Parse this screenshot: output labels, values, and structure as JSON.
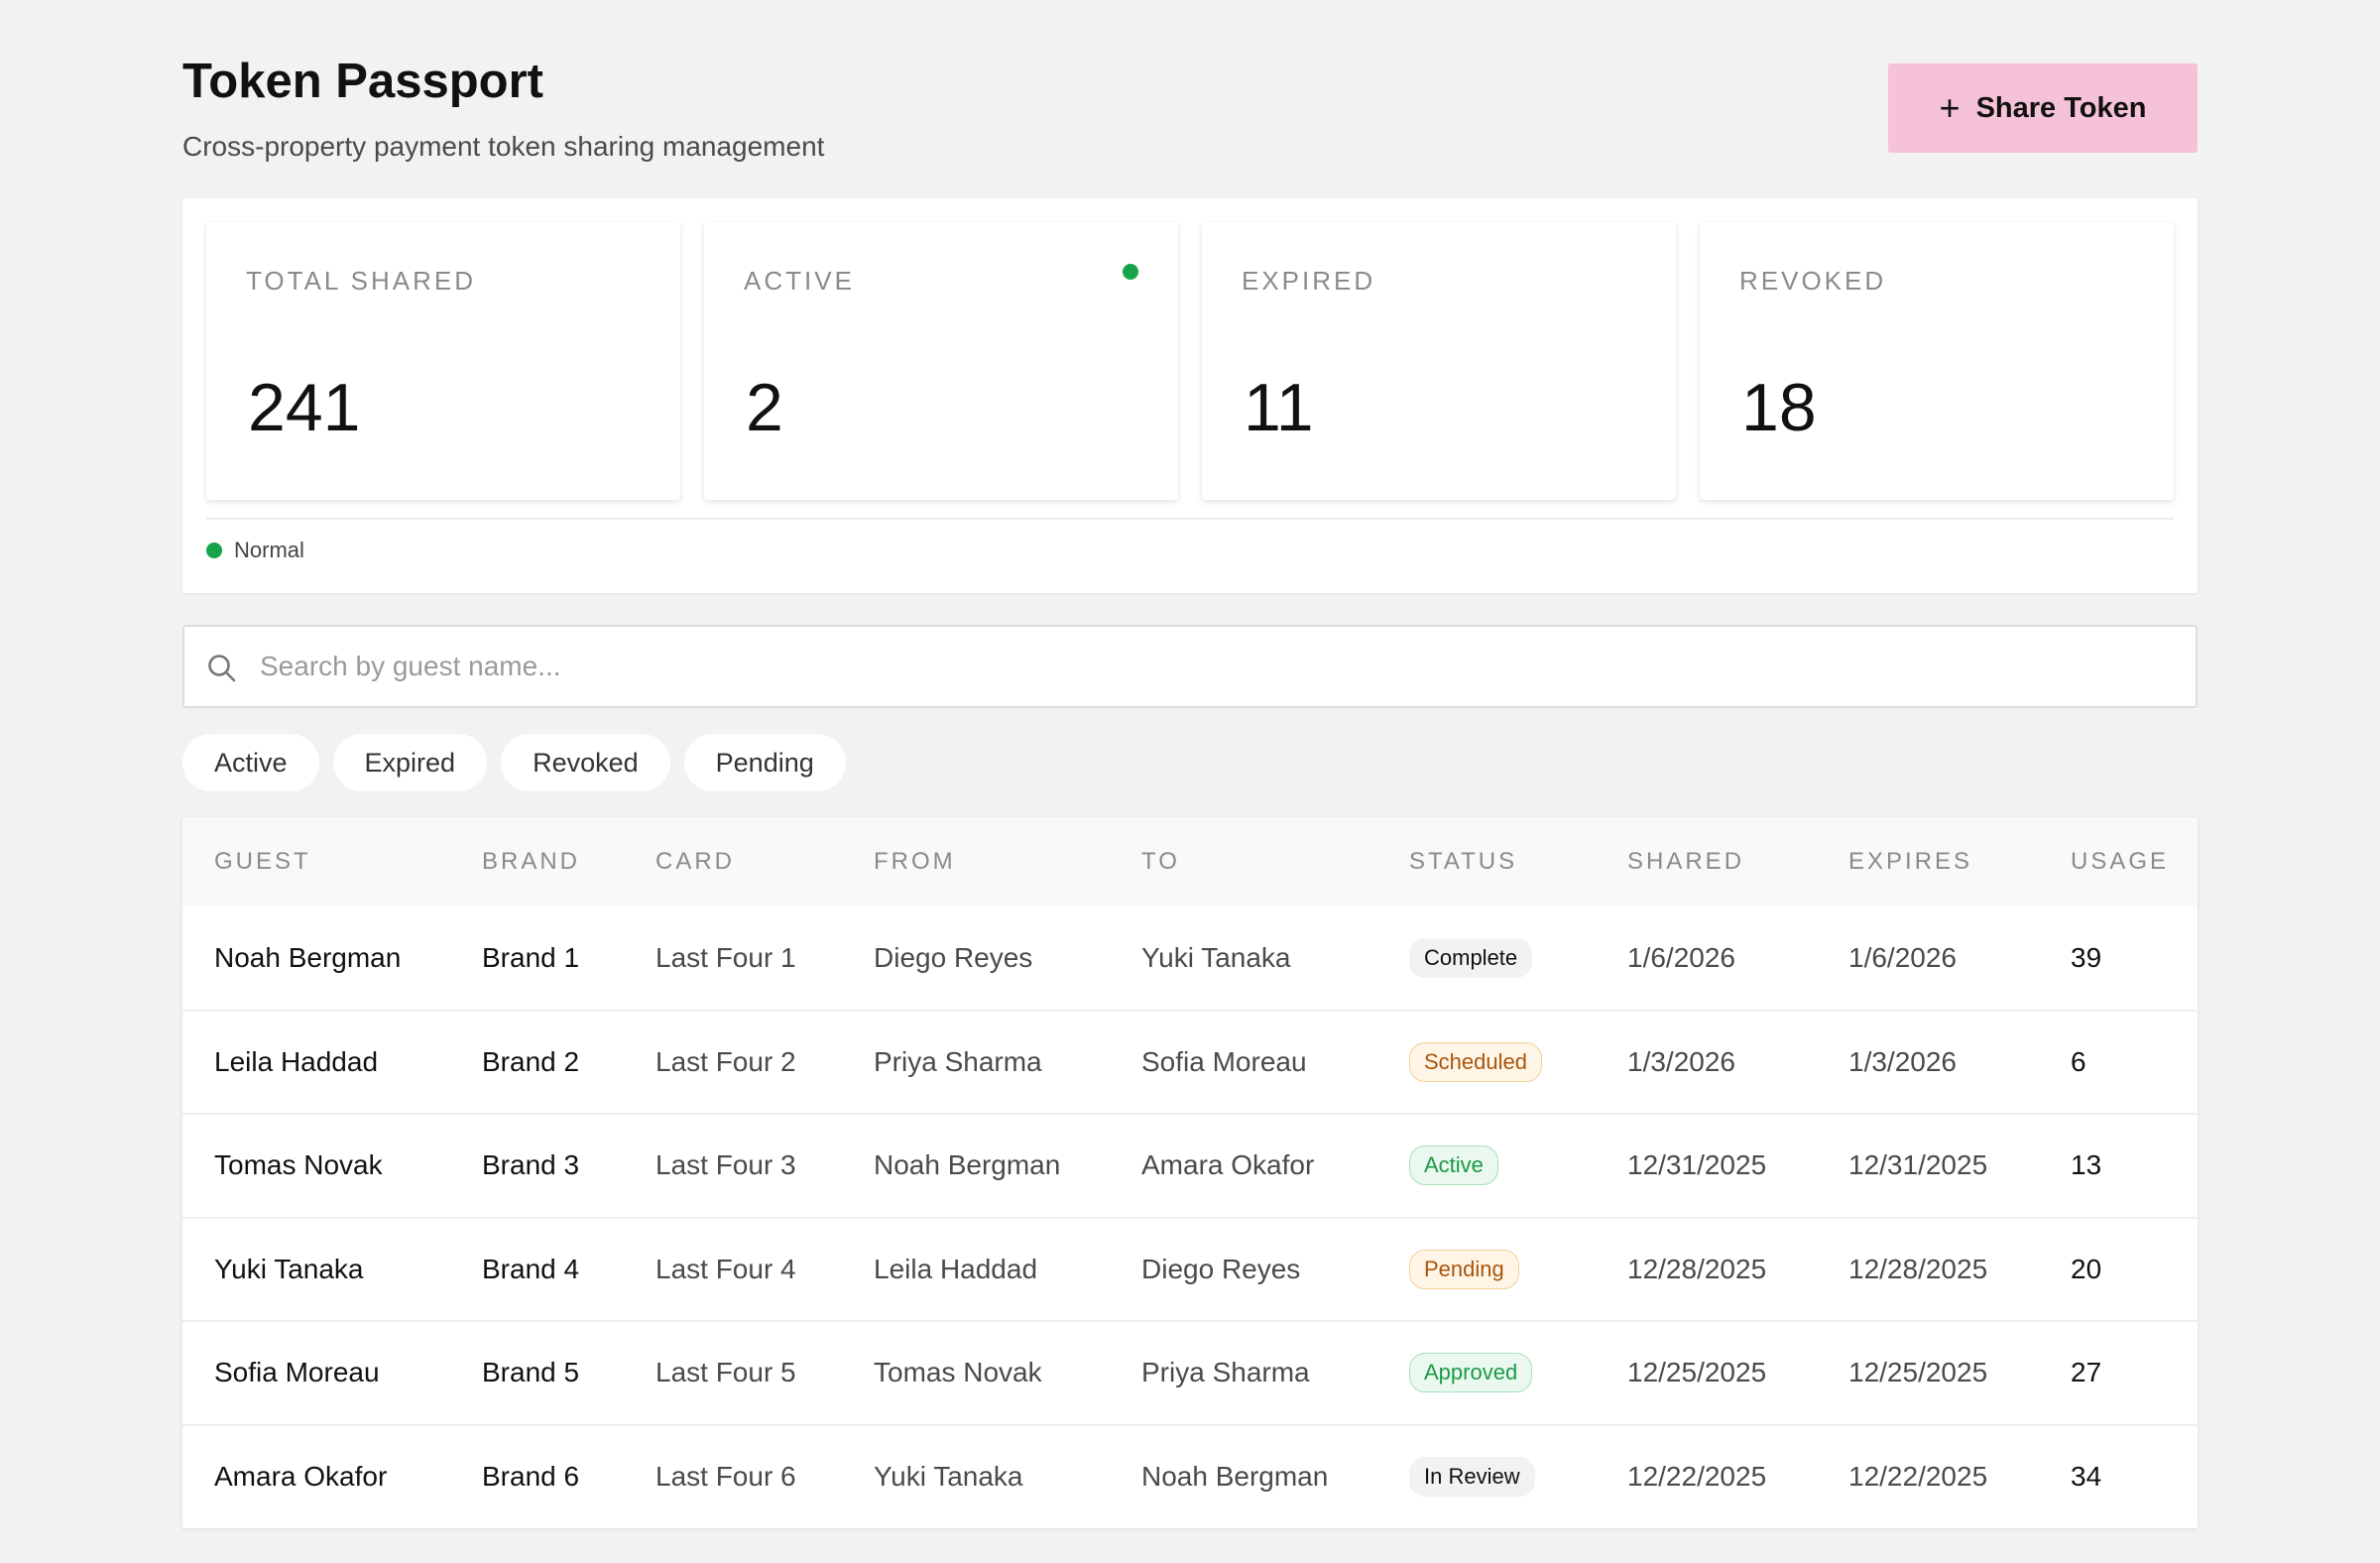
{
  "header": {
    "title": "Token Passport",
    "subtitle": "Cross-property payment token sharing management",
    "share_button": "Share Token"
  },
  "stats": [
    {
      "label": "TOTAL SHARED",
      "value": "241",
      "indicator": false
    },
    {
      "label": "ACTIVE",
      "value": "2",
      "indicator": true
    },
    {
      "label": "EXPIRED",
      "value": "11",
      "indicator": false
    },
    {
      "label": "REVOKED",
      "value": "18",
      "indicator": false
    }
  ],
  "legend": {
    "label": "Normal",
    "color": "#16a34a"
  },
  "search": {
    "placeholder": "Search by guest name...",
    "value": ""
  },
  "filters": [
    "Active",
    "Expired",
    "Revoked",
    "Pending"
  ],
  "table": {
    "columns": [
      "GUEST",
      "BRAND",
      "CARD",
      "FROM",
      "TO",
      "STATUS",
      "SHARED",
      "EXPIRES",
      "USAGE"
    ],
    "rows": [
      {
        "guest": "Noah Bergman",
        "brand": "Brand 1",
        "card": "Last Four 1",
        "from": "Diego Reyes",
        "to": "Yuki Tanaka",
        "status": "Complete",
        "status_style": "neutral",
        "shared": "1/6/2026",
        "expires": "1/6/2026",
        "usage": "39"
      },
      {
        "guest": "Leila Haddad",
        "brand": "Brand 2",
        "card": "Last Four 2",
        "from": "Priya Sharma",
        "to": "Sofia Moreau",
        "status": "Scheduled",
        "status_style": "scheduled",
        "shared": "1/3/2026",
        "expires": "1/3/2026",
        "usage": "6"
      },
      {
        "guest": "Tomas Novak",
        "brand": "Brand 3",
        "card": "Last Four 3",
        "from": "Noah Bergman",
        "to": "Amara Okafor",
        "status": "Active",
        "status_style": "active",
        "shared": "12/31/2025",
        "expires": "12/31/2025",
        "usage": "13"
      },
      {
        "guest": "Yuki Tanaka",
        "brand": "Brand 4",
        "card": "Last Four 4",
        "from": "Leila Haddad",
        "to": "Diego Reyes",
        "status": "Pending",
        "status_style": "pending",
        "shared": "12/28/2025",
        "expires": "12/28/2025",
        "usage": "20"
      },
      {
        "guest": "Sofia Moreau",
        "brand": "Brand 5",
        "card": "Last Four 5",
        "from": "Tomas Novak",
        "to": "Priya Sharma",
        "status": "Approved",
        "status_style": "approved",
        "shared": "12/25/2025",
        "expires": "12/25/2025",
        "usage": "27"
      },
      {
        "guest": "Amara Okafor",
        "brand": "Brand 6",
        "card": "Last Four 6",
        "from": "Yuki Tanaka",
        "to": "Noah Bergman",
        "status": "In Review",
        "status_style": "neutral",
        "shared": "12/22/2025",
        "expires": "12/22/2025",
        "usage": "34"
      }
    ]
  },
  "colors": {
    "accent_button": "#f6c2d8",
    "status_dot": "#16a34a"
  },
  "icons": {
    "search": "search-icon",
    "plus": "plus-icon"
  }
}
